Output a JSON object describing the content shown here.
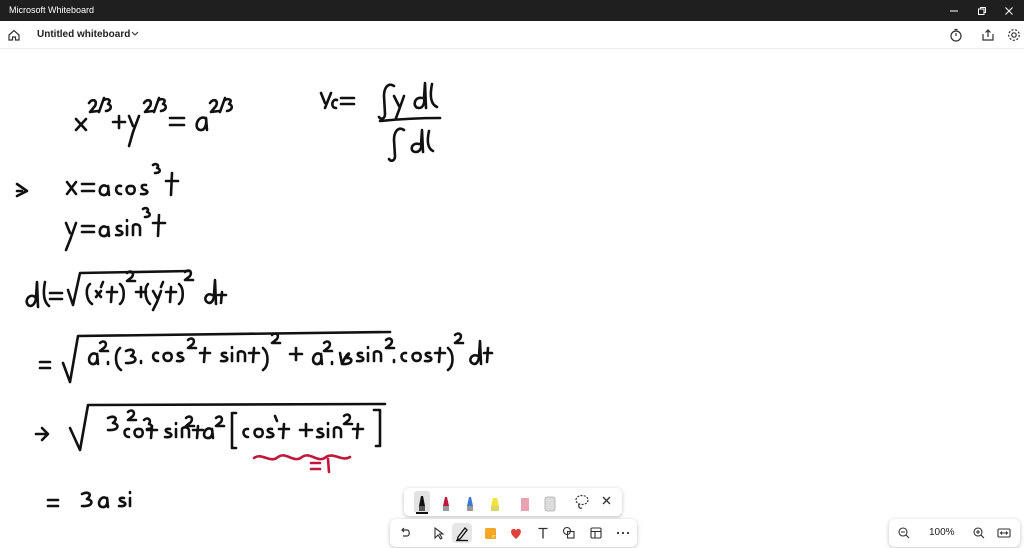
{
  "window": {
    "title": "Microsoft Whiteboard"
  },
  "toolbar": {
    "board_name": "Untitled whiteboard"
  },
  "zoom": {
    "level": "100%"
  },
  "colors": {
    "titlebar": "#1f1f1f",
    "ink_black": "#111111",
    "ink_red": "#c0183c",
    "accent": "#202020"
  },
  "icons": {
    "home": "home-icon",
    "chevron": "chevron-down-icon",
    "timer": "timer-icon",
    "share": "share-icon",
    "settings": "gear-icon"
  }
}
